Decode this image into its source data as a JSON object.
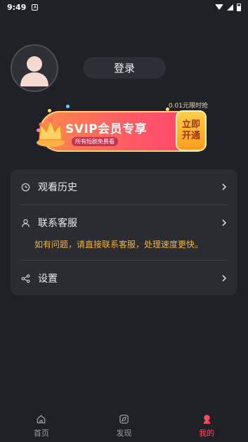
{
  "status_bar": {
    "time": "9:49"
  },
  "profile": {
    "login_label": "登录"
  },
  "svip": {
    "limit_text": "0.01元限时抢",
    "title": "SVIP会员专享",
    "subtitle": "所有短剧免费看",
    "open_line1": "立即",
    "open_line2": "开通"
  },
  "menu": {
    "history_label": "观看历史",
    "service_label": "联系客服",
    "service_note": "如有问题，请直接联系客服，处理速度更快。",
    "settings_label": "设置"
  },
  "bottom_nav": {
    "items": [
      {
        "label": "首页",
        "icon": "home-icon"
      },
      {
        "label": "发现",
        "icon": "discover-icon"
      },
      {
        "label": "我的",
        "icon": "profile-icon"
      }
    ],
    "active_index": 2,
    "active_color": "#ff4a5d"
  },
  "colors": {
    "background": "#1f2126",
    "card": "#2a2c32",
    "note": "#f2b23c",
    "svip_gradient_start": "#ff8a4a",
    "svip_gradient_end": "#ff3f6e"
  }
}
